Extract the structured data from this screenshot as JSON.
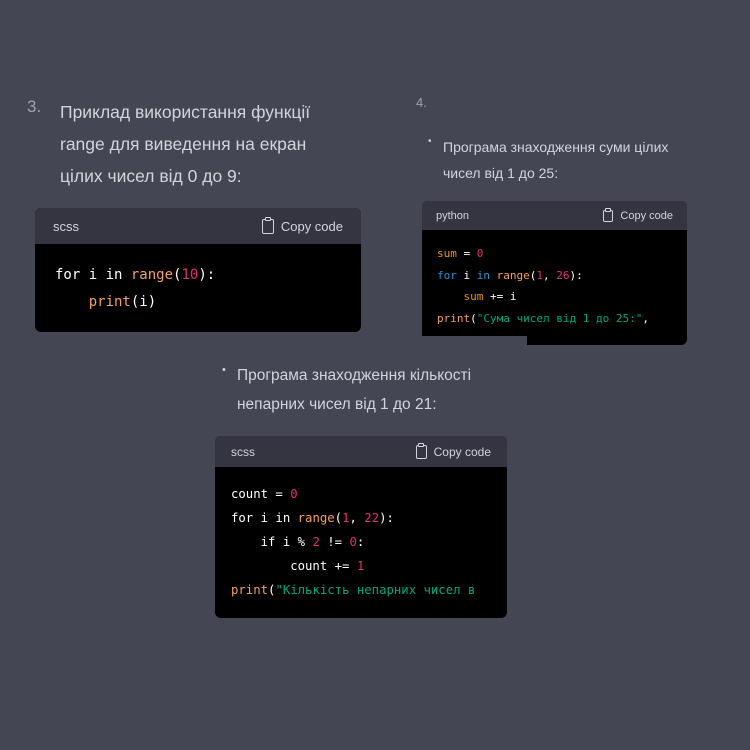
{
  "item3": {
    "number": "3.",
    "lines": [
      "Приклад використання функції",
      "range для виведення на екран",
      "цілих чисел від 0 до 9:"
    ],
    "code": {
      "language": "scss",
      "copy_label": "Copy code",
      "tokens": {
        "l1_for": "for i in ",
        "l1_range": "range",
        "l1_open": "(",
        "l1_num": "10",
        "l1_close": "):",
        "l2_indent": "    ",
        "l2_print": "print",
        "l2_rest": "(i)"
      }
    }
  },
  "item4": {
    "number": "4.",
    "bullet": "•",
    "lines": [
      "Програма знаходження суми цілих",
      "чисел від 1 до 25:"
    ],
    "code": {
      "language": "python",
      "copy_label": "Copy code",
      "tokens": {
        "l1_var": "sum",
        "l1_eq": " = ",
        "l1_num": "0",
        "l2_for": "for",
        "l2_i": " i ",
        "l2_in": "in",
        "l2_sp": " ",
        "l2_range": "range",
        "l2_open": "(",
        "l2_n1": "1",
        "l2_comma": ", ",
        "l2_n2": "26",
        "l2_close": "):",
        "l3_indent": "    ",
        "l3_var": "sum",
        "l3_rest": " += i",
        "l4_print": "print",
        "l4_open": "(",
        "l4_str": "\"Сума чисел від 1 до 25:\"",
        "l4_comma": ","
      }
    }
  },
  "item5": {
    "bullet": "•",
    "lines": [
      "Програма знаходження кількості",
      "непарних чисел від 1 до 21:"
    ],
    "code": {
      "language": "scss",
      "copy_label": "Copy code",
      "tokens": {
        "l1_var": "count = ",
        "l1_num": "0",
        "l2_for": "for i in ",
        "l2_range": "range",
        "l2_open": "(",
        "l2_n1": "1",
        "l2_comma": ", ",
        "l2_n2": "22",
        "l2_close": "):",
        "l3_if": "    if i ",
        "l3_mod": "% ",
        "l3_n": "2",
        "l3_ne": " != ",
        "l3_z": "0",
        "l3_colon": ":",
        "l4_indent": "        count += ",
        "l4_num": "1",
        "l5_print": "print",
        "l5_open": "(",
        "l5_str": "\"Кількість непарних чисел в"
      }
    }
  },
  "colors": {
    "background": "#444654",
    "code_header": "#343541",
    "code_body": "#000000",
    "function": "#f5a062",
    "number": "#df3079",
    "string": "#00a67d",
    "keyword": "#2e95d3"
  },
  "icons": {
    "copy": "clipboard-icon"
  }
}
